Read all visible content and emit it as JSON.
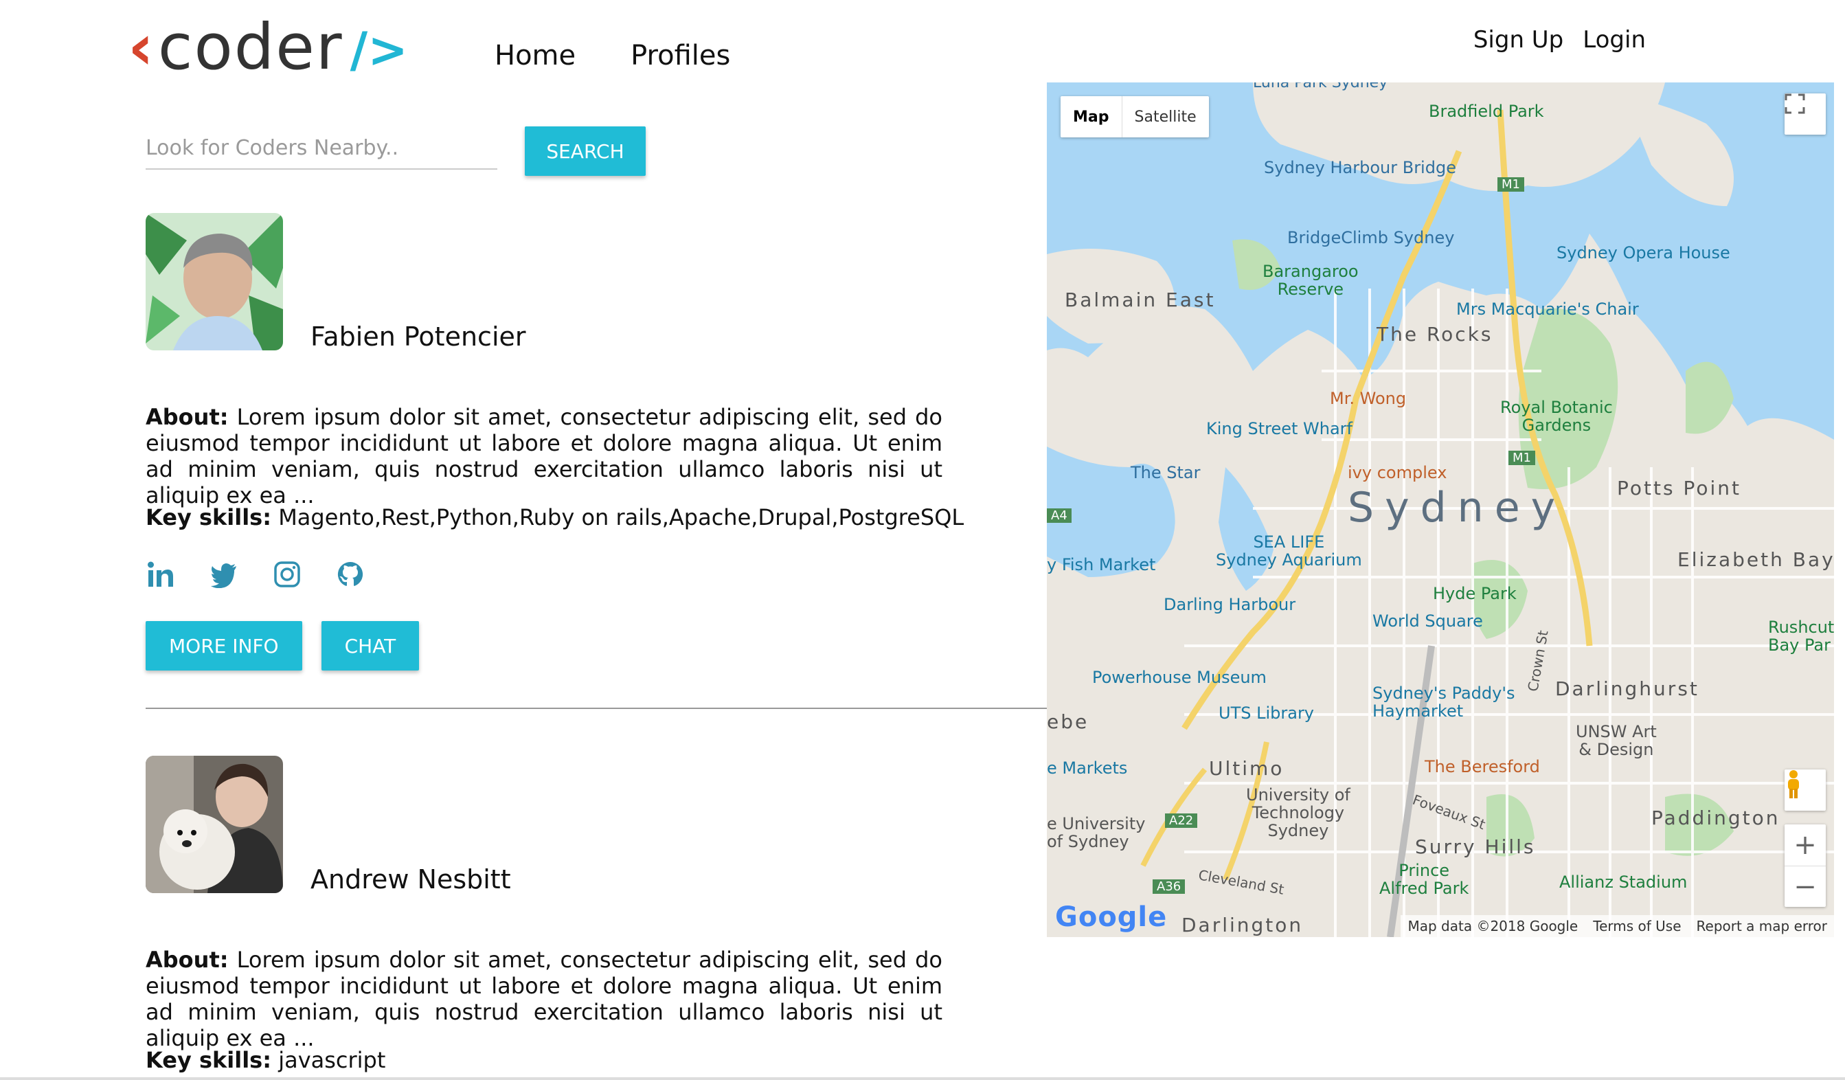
{
  "header": {
    "logo_text": "coder",
    "nav": [
      {
        "label": "Home"
      },
      {
        "label": "Profiles"
      }
    ],
    "auth": {
      "signup": "Sign Up",
      "login": "Login"
    }
  },
  "search": {
    "placeholder": "Look for Coders Nearby..",
    "button": "SEARCH"
  },
  "profiles": [
    {
      "name": "Fabien Potencier",
      "about_label": "About:",
      "about_text": "Lorem ipsum dolor sit amet, consectetur adipiscing elit, sed do eiusmod tempor incididunt ut labore et dolore magna aliqua. Ut enim ad minim veniam, quis nostrud exercitation ullamco laboris nisi ut aliquip ex ea ...",
      "skills_label": "Key skills:",
      "skills": "Magento,Rest,Python,Ruby on rails,Apache,Drupal,PostgreSQL",
      "socials": [
        "linkedin-icon",
        "twitter-icon",
        "instagram-icon",
        "github-icon"
      ],
      "buttons": {
        "more": "MORE INFO",
        "chat": "CHAT"
      }
    },
    {
      "name": "Andrew Nesbitt",
      "about_label": "About:",
      "about_text": "Lorem ipsum dolor sit amet, consectetur adipiscing elit, sed do eiusmod tempor incididunt ut labore et dolore magna aliqua. Ut enim ad minim veniam, quis nostrud exercitation ullamco laboris nisi ut aliquip ex ea ...",
      "skills_label": "Key skills:",
      "skills": "javascript"
    }
  ],
  "map": {
    "type_buttons": [
      "Map",
      "Satellite"
    ],
    "labels": {
      "luna": "Luna Park Sydney",
      "bradfield": "Bradfield Park",
      "harbour_bridge": "Sydney Harbour Bridge",
      "bridgeclimb": "BridgeClimb Sydney",
      "opera": "Sydney Opera House",
      "barangaroo": "Barangaroo\nReserve",
      "balmain": "Balmain East",
      "macquarie": "Mrs Macquarie's Chair",
      "rocks": "The Rocks",
      "mrwong": "Mr. Wong",
      "botanic": "Royal Botanic\nGardens",
      "kingstreet": "King Street Wharf",
      "thestar": "The Star",
      "ivy": "ivy complex",
      "potts": "Potts Point",
      "sydney": "Sydney",
      "sealife": "SEA LIFE\nSydney Aquarium",
      "fishmarket": "y Fish Market",
      "elizabeth": "Elizabeth Bay",
      "hydepark": "Hyde Park",
      "darling": "Darling Harbour",
      "worldsq": "World Square",
      "rushcutter": "Rushcutt\nBay Par",
      "powerhouse": "Powerhouse Museum",
      "crown": "Crown St",
      "paddys": "Sydney's Paddy's\nHaymarket",
      "darlinghurst": "Darlinghurst",
      "glebe": "ebe",
      "uts": "UTS Library",
      "unsw": "UNSW Art\n& Design",
      "markets": "e Markets",
      "ultimo": "Ultimo",
      "uot": "University of\nTechnology\nSydney",
      "beresford": "The Beresford",
      "uni_syd": "e University\nof Sydney",
      "foveaux": "Foveaux St",
      "paddington": "Paddington",
      "surry": "Surry Hills",
      "prince": "Prince\nAlfred Park",
      "allianz": "Allianz Stadium",
      "cleveland": "Cleveland St",
      "darlington": "Darlington",
      "m1a": "M1",
      "m1b": "M1",
      "a4": "A4",
      "a22": "A22",
      "a36": "A36"
    },
    "google": "Google",
    "attribution": [
      "Map data ©2018 Google",
      "Terms of Use",
      "Report a map error"
    ]
  }
}
